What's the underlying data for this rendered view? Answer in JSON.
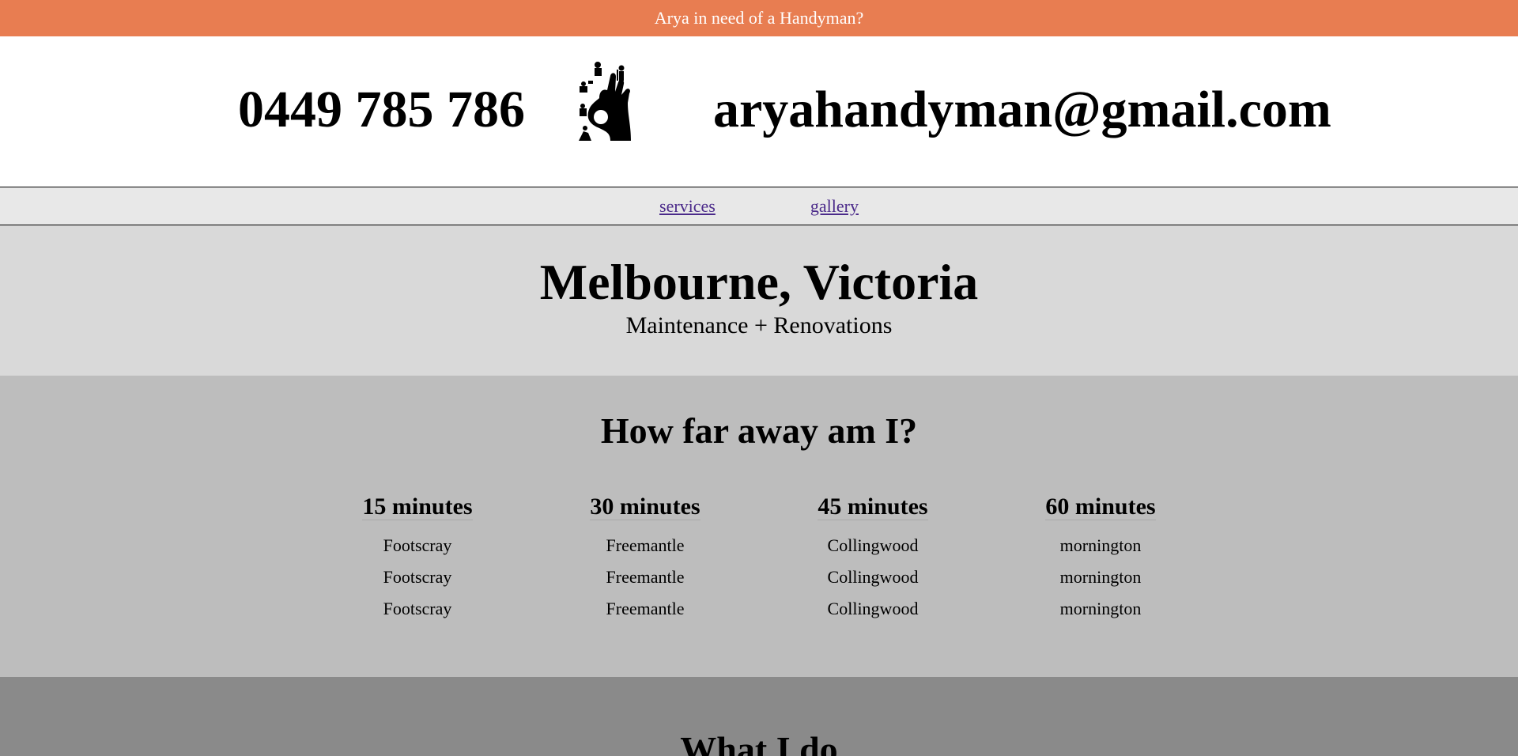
{
  "topbar": {
    "text": "Arya in need of a Handyman?"
  },
  "header": {
    "phone": "0449 785 786",
    "email": "aryahandyman@gmail.com",
    "logo_icon": "ok-hand-tools-icon"
  },
  "nav": {
    "items": [
      {
        "label": "services"
      },
      {
        "label": "gallery"
      }
    ]
  },
  "hero": {
    "title": "Melbourne, Victoria",
    "subtitle": "Maintenance + Renovations"
  },
  "distance": {
    "title": "How far away am I?",
    "columns": [
      {
        "heading": "15 minutes",
        "places": [
          "Footscray",
          "Footscray",
          "Footscray"
        ]
      },
      {
        "heading": "30 minutes",
        "places": [
          "Freemantle",
          "Freemantle",
          "Freemantle"
        ]
      },
      {
        "heading": "45 minutes",
        "places": [
          "Collingwood",
          "Collingwood",
          "Collingwood"
        ]
      },
      {
        "heading": "60 minutes",
        "places": [
          "mornington",
          "mornington",
          "mornington"
        ]
      }
    ]
  },
  "what": {
    "title": "What I do"
  },
  "colors": {
    "topbar": "#e87d51",
    "nav_bg": "#e8e8e8",
    "hero_bg": "#d9d9d9",
    "distance_bg": "#bdbdbd",
    "what_bg": "#8a8a8a",
    "link": "#4b2a8a"
  }
}
